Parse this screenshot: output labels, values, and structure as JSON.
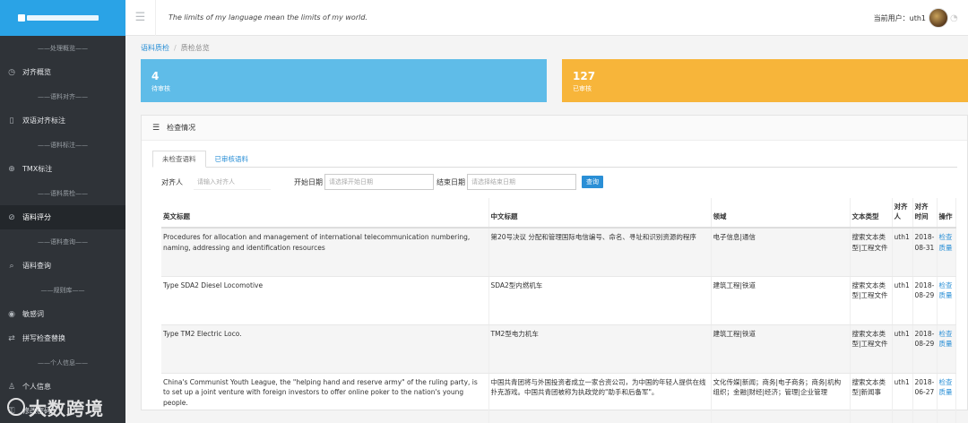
{
  "header": {
    "motto": "The limits of my language mean the limits of my world.",
    "current_user_label": "当前用户：",
    "username": "uth1"
  },
  "sidebar": {
    "groups": [
      "处理概览",
      "语料对齐",
      "语料标注",
      "语料质检",
      "语料查询",
      "规则库",
      "个人信息"
    ],
    "items": [
      {
        "label": "对齐概览",
        "icon": "dashboard-icon"
      },
      {
        "label": "双语对齐标注",
        "icon": "document-icon"
      },
      {
        "label": "TMX标注",
        "icon": "plus-circle-icon"
      },
      {
        "label": "语料评分",
        "icon": "check-circle-icon"
      },
      {
        "label": "语料查询",
        "icon": "search-icon"
      },
      {
        "label": "敏感词",
        "icon": "pin-icon"
      },
      {
        "label": "拼写检查替换",
        "icon": "swap-icon"
      },
      {
        "label": "个人信息",
        "icon": "user-icon"
      },
      {
        "label": "修改密码",
        "icon": "key-icon"
      }
    ]
  },
  "watermark": "大数跨境",
  "breadcrumb": {
    "parent": "语料质检",
    "current": "质检总览"
  },
  "stats": [
    {
      "value": "4",
      "label": "待审核"
    },
    {
      "value": "127",
      "label": "已审核"
    }
  ],
  "panel": {
    "title": "检查情况",
    "tabs": [
      "未检查语料",
      "已审核语料"
    ],
    "filters": {
      "aligner_label": "对齐人",
      "aligner_placeholder": "请输入对齐人",
      "start_label": "开始日期",
      "start_placeholder": "请选择开始日期",
      "end_label": "结束日期",
      "end_placeholder": "请选择结束日期",
      "query_button": "查询"
    },
    "table": {
      "headers": [
        "英文标题",
        "中文标题",
        "领域",
        "文本类型",
        "对齐人",
        "对齐时间",
        "操作"
      ],
      "rows": [
        {
          "en": "Procedures for allocation and management of international telecommunication numbering, naming, addressing and identification resources",
          "zh": "第20号决议 分配和管理国际电信编号、命名、寻址和识别资源的程序",
          "field": "电子信息|通信",
          "type": "搜索文本类型|工程文件",
          "aligner": "uth1",
          "date": "2018-08-31",
          "action": "检查质量"
        },
        {
          "en": "Type SDA2 Diesel Locomotive",
          "zh": "SDA2型内燃机车",
          "field": "建筑工程|铁道",
          "type": "搜索文本类型|工程文件",
          "aligner": "uth1",
          "date": "2018-08-29",
          "action": "检查质量"
        },
        {
          "en": "Type TM2 Electric Loco.",
          "zh": "TM2型电力机车",
          "field": "建筑工程|铁道",
          "type": "搜索文本类型|工程文件",
          "aligner": "uth1",
          "date": "2018-08-29",
          "action": "检查质量"
        },
        {
          "en": "China's Communist Youth League, the \"helping hand and reserve army\" of the ruling party, is to set up a joint venture with foreign investors to offer online poker to the nation's young people.",
          "zh": "中国共青团将与外国投资者成立一家合资公司，为中国的年轻人提供在线扑克游戏。中国共青团被称为执政党的\"助手和后备军\"。",
          "field": "文化传媒|新闻；商务|电子商务；商务|机构组织；金融|财经|经济；管理|企业管理",
          "type": "搜索文本类型|新闻事",
          "aligner": "uth1",
          "date": "2018-06-27",
          "action": "检查质量"
        }
      ]
    }
  }
}
